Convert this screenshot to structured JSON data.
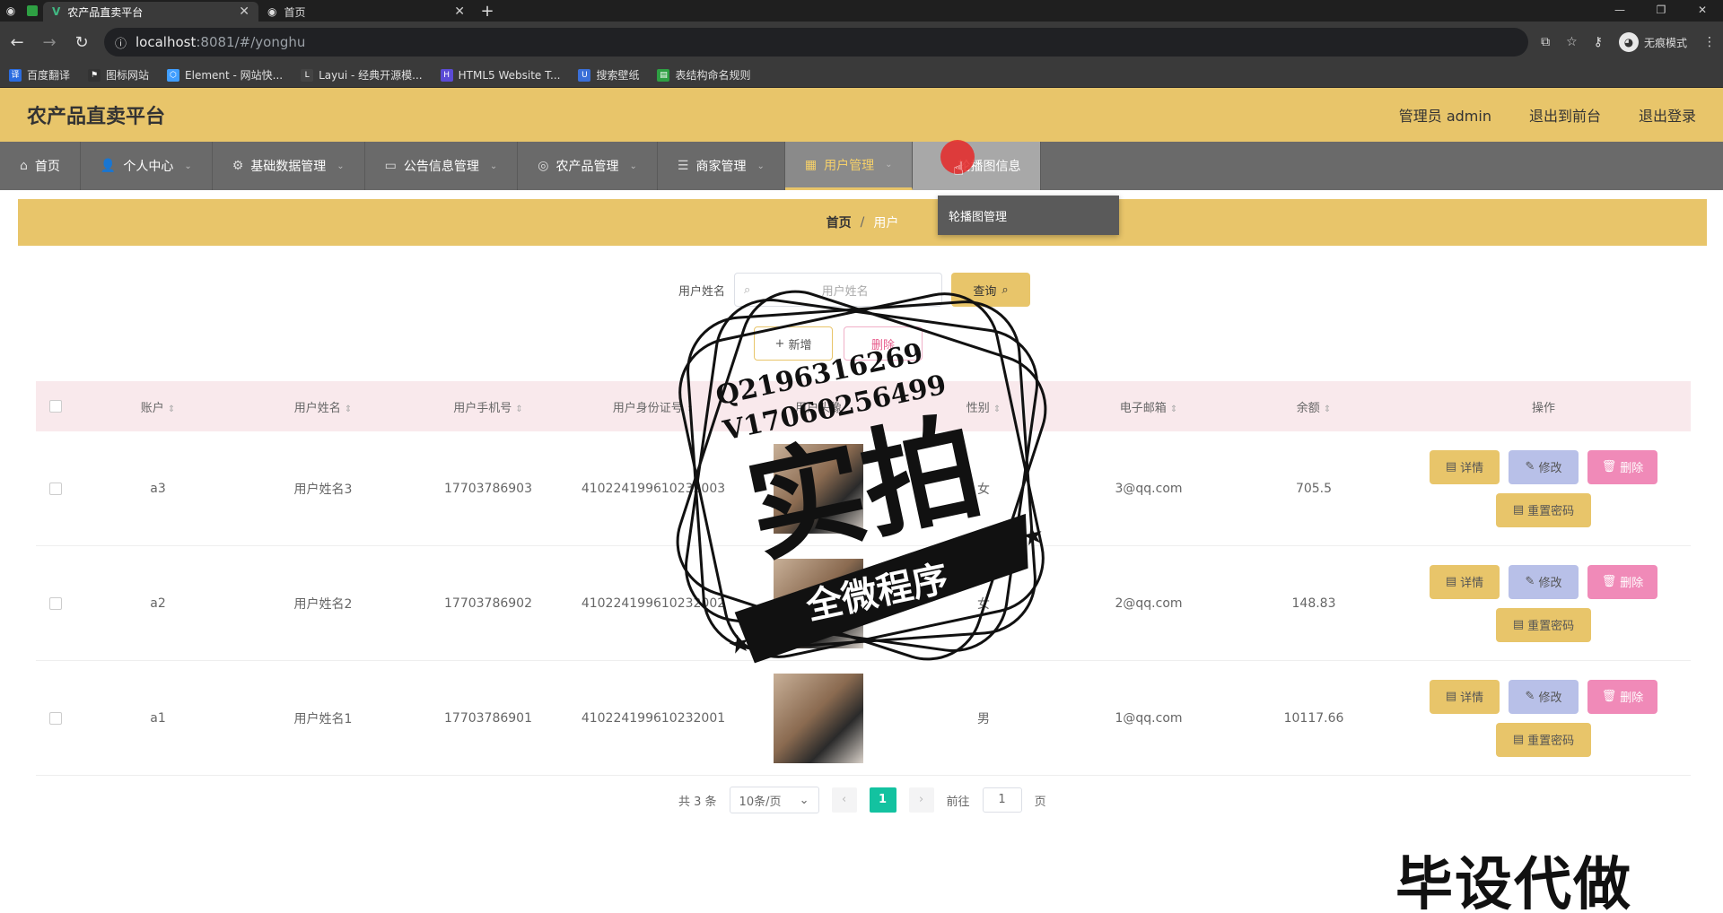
{
  "browser": {
    "tabs": [
      {
        "title": "农产品直卖平台",
        "active": true
      },
      {
        "title": "首页",
        "active": false
      }
    ],
    "url_host": "localhost",
    "url_path": ":8081/#/yonghu",
    "incognito_label": "无痕模式",
    "bookmarks": [
      "百度翻译",
      "图标网站",
      "Element - 网站快...",
      "Layui - 经典开源模...",
      "HTML5 Website T...",
      "搜索壁纸",
      "表结构命名规则"
    ]
  },
  "header": {
    "title": "农产品直卖平台",
    "admin": "管理员 admin",
    "to_front": "退出到前台",
    "logout": "退出登录"
  },
  "menu": {
    "items": [
      {
        "label": "首页"
      },
      {
        "label": "个人中心"
      },
      {
        "label": "基础数据管理"
      },
      {
        "label": "公告信息管理"
      },
      {
        "label": "农产品管理"
      },
      {
        "label": "商家管理"
      },
      {
        "label": "用户管理"
      },
      {
        "label": "轮播图信息"
      }
    ],
    "submenu_item": "轮播图管理"
  },
  "breadcrumb": {
    "home": "首页",
    "sep": "/",
    "current": "用户"
  },
  "search": {
    "label": "用户姓名",
    "placeholder": "用户姓名",
    "button": "查询"
  },
  "actions": {
    "add": "新增",
    "delete": "删除"
  },
  "table": {
    "headers": [
      "账户",
      "用户姓名",
      "用户手机号",
      "用户身份证号",
      "用户头像",
      "性别",
      "电子邮箱",
      "余额",
      "操作"
    ],
    "rows": [
      {
        "account": "a3",
        "name": "用户姓名3",
        "phone": "17703786903",
        "idcard": "410224199610232003",
        "sex": "女",
        "email": "3@qq.com",
        "balance": "705.5"
      },
      {
        "account": "a2",
        "name": "用户姓名2",
        "phone": "17703786902",
        "idcard": "410224199610232002",
        "sex": "女",
        "email": "2@qq.com",
        "balance": "148.83"
      },
      {
        "account": "a1",
        "name": "用户姓名1",
        "phone": "17703786901",
        "idcard": "410224199610232001",
        "sex": "男",
        "email": "1@qq.com",
        "balance": "10117.66"
      }
    ],
    "ops": {
      "detail": "详情",
      "edit": "修改",
      "del": "删除",
      "reset": "重置密码"
    }
  },
  "pager": {
    "total": "共 3 条",
    "size": "10条/页",
    "current": "1",
    "goto": "前往",
    "goto_value": "1",
    "page_unit": "页"
  },
  "watermark": {
    "qq": "Q2196316269",
    "v": "V17060256499",
    "big": "实拍",
    "ribbon": "全微程序",
    "bottom": "毕设代做"
  },
  "colors": {
    "accent": "#e8c56a",
    "menu_bg": "#6a6a6a",
    "pager_active": "#13c2a0"
  }
}
